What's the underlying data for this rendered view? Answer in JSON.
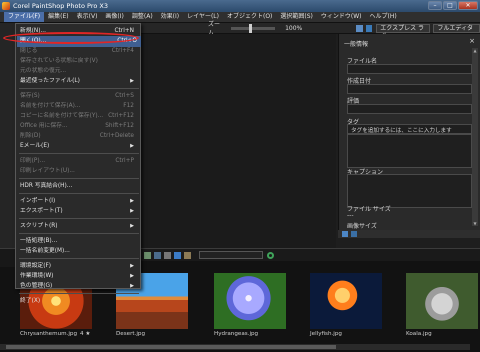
{
  "window": {
    "title": "Corel PaintShop Photo Pro X3"
  },
  "menubar": [
    "ファイル(F)",
    "編集(E)",
    "表示(V)",
    "画像(I)",
    "調整(A)",
    "効果(I)",
    "レイヤー(L)",
    "オブジェクト(O)",
    "選択範囲(S)",
    "ウィンドウ(W)",
    "ヘルプ(H)"
  ],
  "toolbar": {
    "zoom_label": "ズーム",
    "zoom_value": "100%",
    "mode_express": "エクスプレス ラボ",
    "mode_full": "フルエディター"
  },
  "file_menu": [
    {
      "label": "新規(N)...",
      "shortcut": "Ctrl+N",
      "type": "item",
      "state": "normal"
    },
    {
      "label": "開く(O)...",
      "shortcut": "Ctrl+O",
      "type": "item",
      "state": "highlight"
    },
    {
      "label": "閉じる",
      "shortcut": "Ctrl+F4",
      "type": "item",
      "state": "disabled"
    },
    {
      "label": "保存されている状態に戻す(V)",
      "type": "item",
      "state": "disabled"
    },
    {
      "label": "元の状態の復元...",
      "type": "item",
      "state": "disabled"
    },
    {
      "label": "最近使ったファイル(L)",
      "type": "submenu",
      "state": "normal"
    },
    {
      "type": "sep"
    },
    {
      "label": "保存(S)",
      "shortcut": "Ctrl+S",
      "type": "item",
      "state": "disabled"
    },
    {
      "label": "名前を付けて保存(A)...",
      "shortcut": "F12",
      "type": "item",
      "state": "disabled"
    },
    {
      "label": "コピーに名前を付けて保存(Y)...",
      "shortcut": "Ctrl+F12",
      "type": "item",
      "state": "disabled"
    },
    {
      "label": "Office 用に保存...",
      "shortcut": "Shift+F12",
      "type": "item",
      "state": "disabled"
    },
    {
      "label": "削除(D)",
      "shortcut": "Ctrl+Delete",
      "type": "item",
      "state": "disabled"
    },
    {
      "label": "Eメール(E)",
      "type": "submenu",
      "state": "normal"
    },
    {
      "type": "sep"
    },
    {
      "label": "印刷(P)...",
      "shortcut": "Ctrl+P",
      "type": "item",
      "state": "disabled"
    },
    {
      "label": "印刷レイアウト(U)...",
      "type": "item",
      "state": "disabled"
    },
    {
      "type": "sep"
    },
    {
      "label": "HDR 写真結合(H)...",
      "type": "item",
      "state": "normal"
    },
    {
      "type": "sep"
    },
    {
      "label": "インポート(I)",
      "type": "submenu",
      "state": "normal"
    },
    {
      "label": "エクスポート(T)",
      "type": "submenu",
      "state": "normal"
    },
    {
      "type": "sep"
    },
    {
      "label": "スクリプト(R)",
      "type": "submenu",
      "state": "normal"
    },
    {
      "type": "sep"
    },
    {
      "label": "一括処理(B)...",
      "type": "item",
      "state": "normal"
    },
    {
      "label": "一括名前変更(M)...",
      "type": "item",
      "state": "normal"
    },
    {
      "type": "sep"
    },
    {
      "label": "環境設定(F)",
      "type": "submenu",
      "state": "normal"
    },
    {
      "label": "作業環境(W)",
      "type": "submenu",
      "state": "normal"
    },
    {
      "label": "色の管理(G)",
      "type": "submenu",
      "state": "normal"
    },
    {
      "type": "sep"
    },
    {
      "label": "終了(X)",
      "type": "item",
      "state": "normal"
    }
  ],
  "info_panel": {
    "title": "一般情報",
    "close": "×",
    "fields": [
      "ファイル名",
      "作成日付",
      "評価",
      "タグ",
      "キャプション",
      "ファイル サイズ",
      "画像サイズ"
    ],
    "tag_placeholder": "タグを追加するには、ここに入力します",
    "file_size_value": "---"
  },
  "thumbnails": [
    {
      "name": "Chrysanthemum.jpg",
      "meta": "4 ★"
    },
    {
      "name": "Desert.jpg"
    },
    {
      "name": "Hydrangeas.jpg"
    },
    {
      "name": "Jellyfish.jpg"
    },
    {
      "name": "Koala.jpg"
    }
  ],
  "colors": {
    "menu_highlight": "#3f5f91",
    "annotation_ring": "#e02626",
    "titlebar": "#2c4a6c"
  }
}
